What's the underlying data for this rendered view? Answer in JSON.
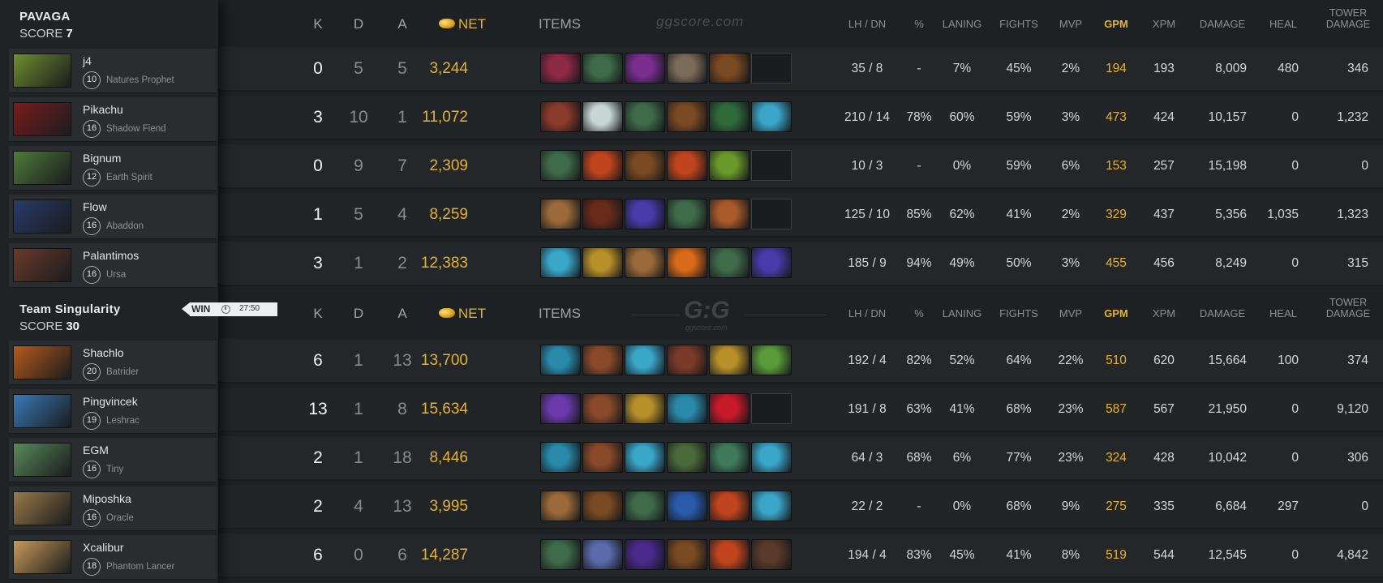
{
  "teams": [
    {
      "name": "PAVAGA",
      "score_label": "SCORE",
      "score": "7",
      "players": [
        {
          "name": "j4",
          "level": "10",
          "hero": "Natures Prophet",
          "portrait_color": "#6f8f2e",
          "k": "0",
          "d": "5",
          "a": "5",
          "net": "3,244",
          "lh_dn": "35  /  8",
          "pct": "-",
          "laning": "7%",
          "fights": "45%",
          "mvp": "2%",
          "gpm": "194",
          "xpm": "193",
          "damage": "8,009",
          "heal": "480",
          "tower": "346",
          "items": [
            "#8d2a45",
            "#3f6b4a",
            "#7a2f8f",
            "#7b6b5a",
            "#7a4a22",
            "empty"
          ]
        },
        {
          "name": "Pikachu",
          "level": "16",
          "hero": "Shadow Fiend",
          "portrait_color": "#7a1c1c",
          "k": "3",
          "d": "10",
          "a": "1",
          "net": "11,072",
          "lh_dn": "210  /  14",
          "pct": "78%",
          "laning": "60%",
          "fights": "59%",
          "mvp": "3%",
          "gpm": "473",
          "xpm": "424",
          "damage": "10,157",
          "heal": "0",
          "tower": "1,232",
          "items": [
            "#8a3b2a",
            "#c8d6d4",
            "#3f6b4a",
            "#7a4a22",
            "#2f6a3a",
            "#3aa6c8"
          ]
        },
        {
          "name": "Bignum",
          "level": "12",
          "hero": "Earth Spirit",
          "portrait_color": "#4f7a3a",
          "k": "0",
          "d": "9",
          "a": "7",
          "net": "2,309",
          "lh_dn": "10  /  3",
          "pct": "-",
          "laning": "0%",
          "fights": "59%",
          "mvp": "6%",
          "gpm": "153",
          "xpm": "257",
          "damage": "15,198",
          "heal": "0",
          "tower": "0",
          "items": [
            "#3f6b4a",
            "#c0451e",
            "#7a4a22",
            "#c0451e",
            "#6a9a2a",
            "empty"
          ]
        },
        {
          "name": "Flow",
          "level": "16",
          "hero": "Abaddon",
          "portrait_color": "#2a3a6a",
          "k": "1",
          "d": "5",
          "a": "4",
          "net": "8,259",
          "lh_dn": "125  /  10",
          "pct": "85%",
          "laning": "62%",
          "fights": "41%",
          "mvp": "2%",
          "gpm": "329",
          "xpm": "437",
          "damage": "5,356",
          "heal": "1,035",
          "tower": "1,323",
          "items": [
            "#9a6a3a",
            "#6a2a1a",
            "#4a3aaa",
            "#3f6b4a",
            "#a85a2a",
            "empty"
          ]
        },
        {
          "name": "Palantimos",
          "level": "16",
          "hero": "Ursa",
          "portrait_color": "#6a3a2a",
          "k": "3",
          "d": "1",
          "a": "2",
          "net": "12,383",
          "lh_dn": "185  /  9",
          "pct": "94%",
          "laning": "49%",
          "fights": "50%",
          "mvp": "3%",
          "gpm": "455",
          "xpm": "456",
          "damage": "8,249",
          "heal": "0",
          "tower": "315",
          "items": [
            "#3aa6c8",
            "#b8902a",
            "#9a6a3a",
            "#d86a1a",
            "#3f6b4a",
            "#4a3aaa"
          ]
        }
      ]
    },
    {
      "name": "Team Singularity",
      "score_label": "SCORE",
      "score": "30",
      "players": [
        {
          "name": "Shachlo",
          "level": "20",
          "hero": "Batrider",
          "portrait_color": "#b85a1a",
          "k": "6",
          "d": "1",
          "a": "13",
          "net": "13,700",
          "lh_dn": "192  /  4",
          "pct": "82%",
          "laning": "52%",
          "fights": "64%",
          "mvp": "22%",
          "gpm": "510",
          "xpm": "620",
          "damage": "15,664",
          "heal": "100",
          "tower": "374",
          "items": [
            "#2a8aaa",
            "#8a4a2a",
            "#3aa6c8",
            "#7a3a2a",
            "#b8902a",
            "#5a9a3a"
          ]
        },
        {
          "name": "Pingvincek",
          "level": "19",
          "hero": "Leshrac",
          "portrait_color": "#3a7ab8",
          "k": "13",
          "d": "1",
          "a": "8",
          "net": "15,634",
          "lh_dn": "191  /  8",
          "pct": "63%",
          "laning": "41%",
          "fights": "68%",
          "mvp": "23%",
          "gpm": "587",
          "xpm": "567",
          "damage": "21,950",
          "heal": "0",
          "tower": "9,120",
          "items": [
            "#6a3aaa",
            "#8a4a2a",
            "#b8902a",
            "#2a8aaa",
            "#c81a2a",
            "empty"
          ]
        },
        {
          "name": "EGM",
          "level": "16",
          "hero": "Tiny",
          "portrait_color": "#5a8a5a",
          "k": "2",
          "d": "1",
          "a": "18",
          "net": "8,446",
          "lh_dn": "64  /  3",
          "pct": "68%",
          "laning": "6%",
          "fights": "77%",
          "mvp": "23%",
          "gpm": "324",
          "xpm": "428",
          "damage": "10,042",
          "heal": "0",
          "tower": "306",
          "items": [
            "#2a8aaa",
            "#8a4a2a",
            "#3aa6c8",
            "#4a6a3a",
            "#3f7a5a",
            "#3aa6c8"
          ]
        },
        {
          "name": "Miposhka",
          "level": "16",
          "hero": "Oracle",
          "portrait_color": "#9a7a4a",
          "k": "2",
          "d": "4",
          "a": "13",
          "net": "3,995",
          "lh_dn": "22  /  2",
          "pct": "-",
          "laning": "0%",
          "fights": "68%",
          "mvp": "9%",
          "gpm": "275",
          "xpm": "335",
          "damage": "6,684",
          "heal": "297",
          "tower": "0",
          "items": [
            "#9a6a3a",
            "#7a4a22",
            "#3f6b4a",
            "#2a5aaa",
            "#c0451e",
            "#3aa6c8"
          ]
        },
        {
          "name": "Xcalibur",
          "level": "18",
          "hero": "Phantom Lancer",
          "portrait_color": "#c89a5a",
          "k": "6",
          "d": "0",
          "a": "6",
          "net": "14,287",
          "lh_dn": "194  /  4",
          "pct": "83%",
          "laning": "45%",
          "fights": "41%",
          "mvp": "8%",
          "gpm": "519",
          "xpm": "544",
          "damage": "12,545",
          "heal": "0",
          "tower": "4,842",
          "items": [
            "#3f6b4a",
            "#5a6aaa",
            "#4a2a8a",
            "#7a4a22",
            "#c0451e",
            "#5a3a2a"
          ]
        }
      ]
    }
  ],
  "result": {
    "label": "WIN",
    "duration": "27:50"
  },
  "headers": {
    "k": "K",
    "d": "D",
    "a": "A",
    "net": "NET",
    "items": "ITEMS",
    "lh_dn": "LH  /  DN",
    "pct": "%",
    "laning": "LANING",
    "fights": "FIGHTS",
    "mvp": "MVP",
    "gpm": "GPM",
    "xpm": "XPM",
    "damage": "DAMAGE",
    "heal": "HEAL",
    "tower_line1": "TOWER",
    "tower_line2": "DAMAGE"
  },
  "watermark": {
    "site": "ggscore.com",
    "logo": "G:G"
  },
  "colors": {
    "gold": "#e6b233",
    "background": "#1e2124"
  }
}
